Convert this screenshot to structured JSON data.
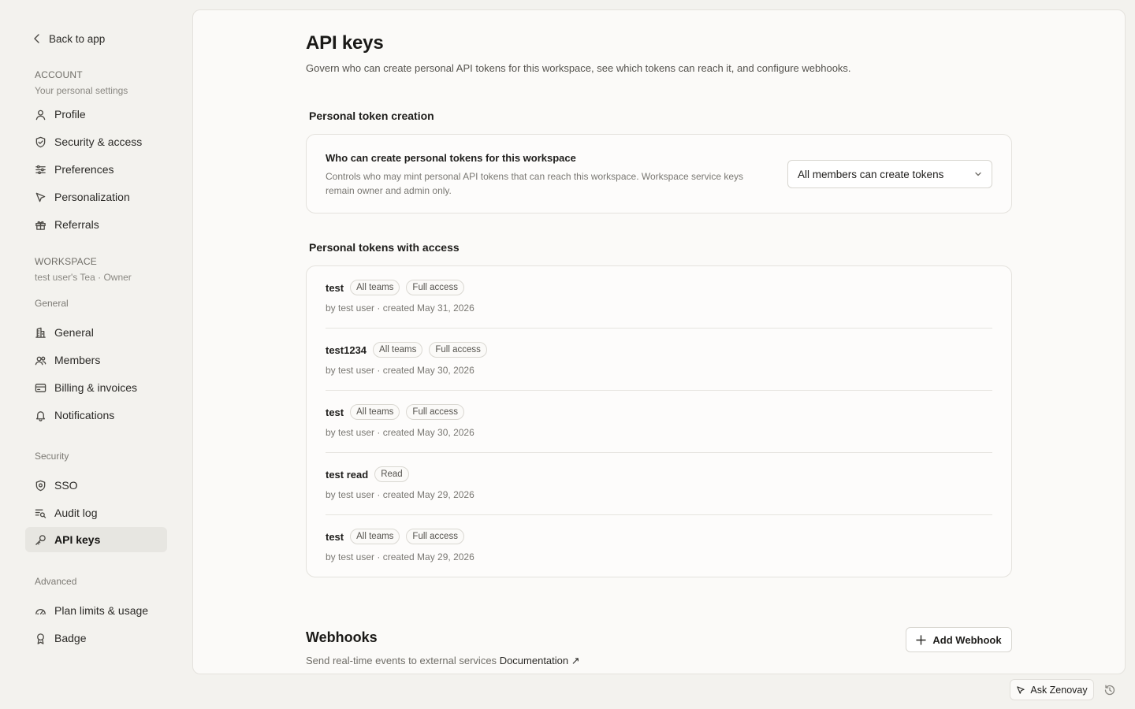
{
  "sidebar": {
    "back_label": "Back to app",
    "account": {
      "title": "ACCOUNT",
      "subtitle": "Your personal settings",
      "items": [
        {
          "label": "Profile",
          "icon": "user-icon"
        },
        {
          "label": "Security & access",
          "icon": "shield-icon"
        },
        {
          "label": "Preferences",
          "icon": "sliders-icon"
        },
        {
          "label": "Personalization",
          "icon": "cursor-icon"
        },
        {
          "label": "Referrals",
          "icon": "gift-icon"
        }
      ]
    },
    "workspace": {
      "title": "WORKSPACE",
      "subtitle": "test user's Tea · Owner"
    },
    "general_group": {
      "label": "General",
      "items": [
        {
          "label": "General",
          "icon": "building-icon"
        },
        {
          "label": "Members",
          "icon": "users-icon"
        },
        {
          "label": "Billing & invoices",
          "icon": "card-icon"
        },
        {
          "label": "Notifications",
          "icon": "bell-icon"
        }
      ]
    },
    "security_group": {
      "label": "Security",
      "items": [
        {
          "label": "SSO",
          "icon": "shield-check-icon"
        },
        {
          "label": "Audit log",
          "icon": "list-search-icon"
        },
        {
          "label": "API keys",
          "icon": "key-icon",
          "active": true
        }
      ]
    },
    "advanced_group": {
      "label": "Advanced",
      "items": [
        {
          "label": "Plan limits & usage",
          "icon": "gauge-icon"
        },
        {
          "label": "Badge",
          "icon": "award-icon"
        }
      ]
    }
  },
  "main": {
    "title": "API keys",
    "description": "Govern who can create personal API tokens for this workspace, see which tokens can reach it, and configure webhooks.",
    "token_creation": {
      "heading": "Personal token creation",
      "setting_title": "Who can create personal tokens for this workspace",
      "setting_desc": "Controls who may mint personal API tokens that can reach this workspace. Workspace service keys remain owner and admin only.",
      "select_value": "All members can create tokens"
    },
    "tokens": {
      "heading": "Personal tokens with access",
      "items": [
        {
          "name": "test",
          "badges": [
            "All teams",
            "Full access"
          ],
          "meta": "by test user · created May 31, 2026"
        },
        {
          "name": "test1234",
          "badges": [
            "All teams",
            "Full access"
          ],
          "meta": "by test user · created May 30, 2026"
        },
        {
          "name": "test",
          "badges": [
            "All teams",
            "Full access"
          ],
          "meta": "by test user · created May 30, 2026"
        },
        {
          "name": "test read",
          "badges": [
            "Read"
          ],
          "meta": "by test user · created May 29, 2026"
        },
        {
          "name": "test",
          "badges": [
            "All teams",
            "Full access"
          ],
          "meta": "by test user · created May 29, 2026"
        }
      ]
    },
    "webhooks": {
      "title": "Webhooks",
      "description": "Send real-time events to external services",
      "doc_link": "Documentation",
      "doc_arrow": "↗",
      "add_button": "Add Webhook",
      "add_icon": "plus-icon"
    }
  },
  "footer": {
    "ask_label": "Ask Zenovay",
    "ask_icon": "cursor-icon",
    "history_icon": "history-icon"
  }
}
